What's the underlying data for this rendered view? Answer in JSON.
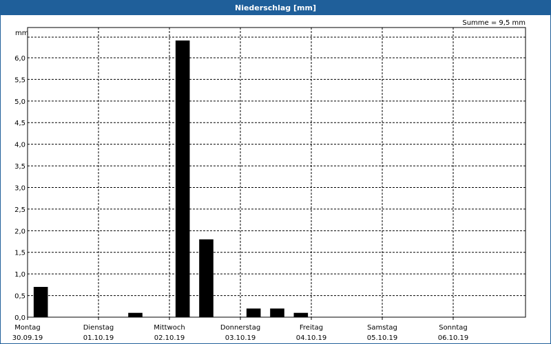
{
  "chart_data": {
    "type": "bar",
    "title": "Niederschlag [mm]",
    "ylabel": "mm",
    "annotation": "Summe = 9,5 mm",
    "ylim": [
      0,
      6.7
    ],
    "yticks": [
      "0,0",
      "0,5",
      "1,0",
      "1,5",
      "2,0",
      "2,5",
      "3,0",
      "3,5",
      "4,0",
      "4,5",
      "5,0",
      "5,5",
      "6,0"
    ],
    "grid": true,
    "days": [
      {
        "weekday": "Montag",
        "date": "30.09.19"
      },
      {
        "weekday": "Dienstag",
        "date": "01.10.19"
      },
      {
        "weekday": "Mittwoch",
        "date": "02.10.19"
      },
      {
        "weekday": "Donnerstag",
        "date": "03.10.19"
      },
      {
        "weekday": "Freitag",
        "date": "04.10.19"
      },
      {
        "weekday": "Samstag",
        "date": "05.10.19"
      },
      {
        "weekday": "Sonntag",
        "date": "06.10.19"
      }
    ],
    "bar_interval_hours": 8,
    "values": [
      0.7,
      0,
      0,
      0,
      0.1,
      0,
      6.4,
      1.8,
      0,
      0.2,
      0.2,
      0.1,
      0,
      0,
      0,
      0,
      0,
      0,
      0,
      0,
      0
    ],
    "bar_color": "#000000"
  }
}
